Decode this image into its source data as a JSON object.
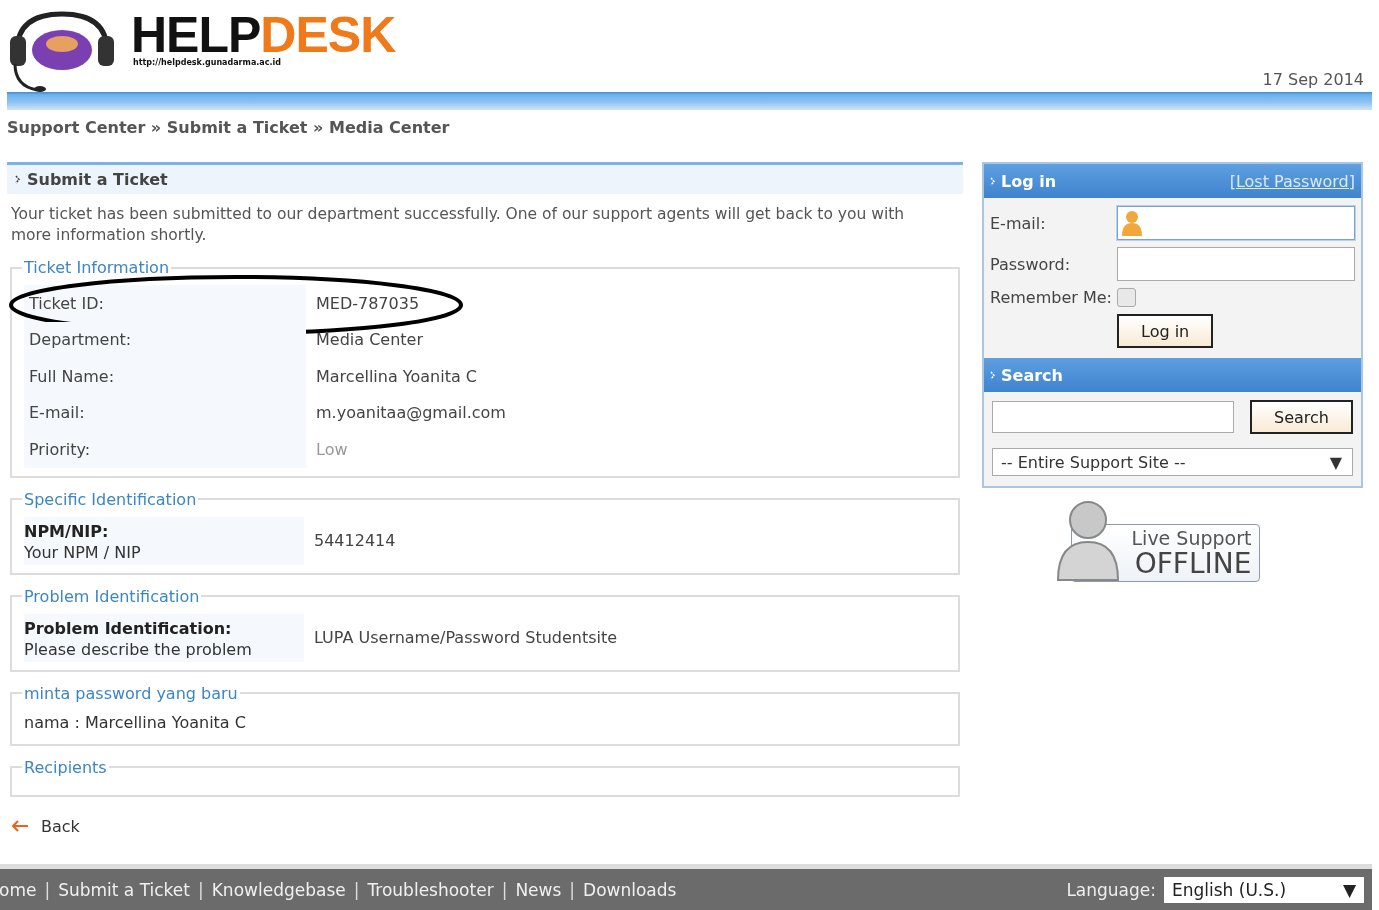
{
  "header": {
    "logo": {
      "dark": "HELP",
      "accent": "DESK",
      "url": "http://helpdesk.gunadarma.ac.id"
    },
    "date": "17 Sep 2014"
  },
  "breadcrumb": {
    "separator": "»",
    "items": [
      "Support Center",
      "Submit a Ticket",
      "Media Center"
    ]
  },
  "main": {
    "title": "Submit a Ticket",
    "message": "Your ticket has been submitted to our department successfully. One of our support agents will get back to you with more information shortly.",
    "sections": [
      {
        "legend": "Ticket Information",
        "kind": "fields",
        "rows": [
          {
            "label": "Ticket ID:",
            "value": "MED-787035",
            "muted": false,
            "highlighted": true
          },
          {
            "label": "Department:",
            "value": "Media Center",
            "muted": false,
            "highlighted": false
          },
          {
            "label": "Full Name:",
            "value": "Marcellina Yoanita C",
            "muted": false,
            "highlighted": false
          },
          {
            "label": "E-mail:",
            "value": "m.yoanitaa@gmail.com",
            "muted": false,
            "highlighted": false
          },
          {
            "label": "Priority:",
            "value": "Low",
            "muted": true,
            "highlighted": false
          }
        ]
      },
      {
        "legend": "Specific Identification",
        "kind": "custom",
        "label": "NPM/NIP:",
        "hint": "Your NPM / NIP",
        "value": "54412414"
      },
      {
        "legend": "Problem Identification",
        "kind": "custom",
        "label": "Problem Identification:",
        "hint": "Please describe the problem",
        "value": "LUPA Username/Password Studentsite"
      },
      {
        "legend": "minta password yang baru",
        "kind": "text",
        "text": "nama : Marcellina Yoanita C"
      },
      {
        "legend": "Recipients",
        "kind": "empty"
      }
    ]
  },
  "back": {
    "label": "Back"
  },
  "login": {
    "title": "Log in",
    "lost_password": "[Lost Password]",
    "email_label": "E-mail:",
    "password_label": "Password:",
    "remember_label": "Remember Me:",
    "remember_checked": false,
    "button": "Log in"
  },
  "search": {
    "title": "Search",
    "button": "Search",
    "scope": "-- Entire Support Site --",
    "caret": "▼"
  },
  "live_support": {
    "line1": "Live Support",
    "line2": "OFFLINE"
  },
  "footer": {
    "links": [
      "ome",
      "Submit a Ticket",
      "Knowledgebase",
      "Troubleshooter",
      "News",
      "Downloads"
    ],
    "separator": "|",
    "language_label": "Language:",
    "language": "English (U.S.)",
    "caret": "▼"
  }
}
